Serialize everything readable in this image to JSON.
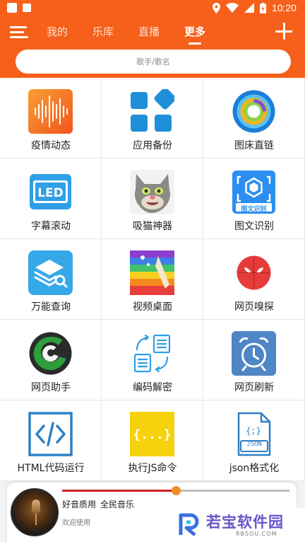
{
  "status_bar": {
    "time": "10:20"
  },
  "nav": {
    "tabs": [
      {
        "label": "我的",
        "active": false
      },
      {
        "label": "乐库",
        "active": false
      },
      {
        "label": "直播",
        "active": false
      },
      {
        "label": "更多",
        "active": true
      }
    ]
  },
  "search": {
    "placeholder": "歌手/歌名"
  },
  "grid": {
    "items": [
      {
        "label": "疫情动态",
        "icon": "soundwave-icon"
      },
      {
        "label": "应用备份",
        "icon": "app-grid-icon"
      },
      {
        "label": "图床直链",
        "icon": "ring-logo-icon"
      },
      {
        "label": "字幕滚动",
        "icon": "led-icon"
      },
      {
        "label": "吸猫神器",
        "icon": "tom-cat-icon"
      },
      {
        "label": "图文识别",
        "icon": "ocr-scan-icon",
        "badge": "图文识别"
      },
      {
        "label": "万能查询",
        "icon": "layers-search-icon"
      },
      {
        "label": "视频桌面",
        "icon": "rainbow-video-icon"
      },
      {
        "label": "网页嗅探",
        "icon": "spider-icon"
      },
      {
        "label": "网页助手",
        "icon": "swirl-logo-icon"
      },
      {
        "label": "编码解密",
        "icon": "convert-docs-icon"
      },
      {
        "label": "网页刷新",
        "icon": "alarm-clock-icon"
      },
      {
        "label": "HTML代码运行",
        "icon": "code-brackets-icon"
      },
      {
        "label": "执行JS命令",
        "icon": "js-braces-icon"
      },
      {
        "label": "json格式化",
        "icon": "json-file-icon",
        "badge": "JSON"
      }
    ]
  },
  "player": {
    "quality": "好音质用",
    "app_name": "全民音乐",
    "subtitle": "欢迎使用",
    "progress": 0.5
  },
  "watermark": {
    "text": "若宝软件园",
    "url": "RBSOU.COM"
  },
  "colors": {
    "brand": "#f6601a",
    "progress_fill": "#d32222",
    "progress_knob": "#f28c28"
  }
}
